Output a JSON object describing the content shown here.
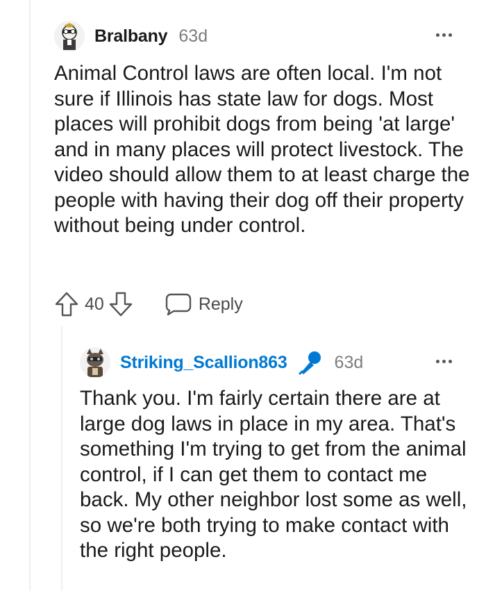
{
  "comments": [
    {
      "username": "Bralbany",
      "time": "63d",
      "avatar": "bralbany-avatar",
      "body": "Animal Control laws are often local. I'm not sure if Illinois has state law for dogs. Most places will prohibit dogs from being 'at large' and in many places will protect livestock. The video should allow them to at least charge the people with having their dog off their property without being under control.",
      "votes": "40",
      "reply_label": "Reply"
    },
    {
      "username": "Striking_Scallion863",
      "time": "63d",
      "is_op": true,
      "badge_icon": "microphone-icon",
      "avatar": "scallion-avatar",
      "body": "Thank you. I'm fairly certain there are at large dog laws in place in my area. That's something I'm trying to get from the animal control, if I can get them to contact me back. My other neighbor lost some as well, so we're both trying to make contact with the right people."
    }
  ],
  "colors": {
    "op_username": "#0079d3",
    "timestamp": "#7c7c7c",
    "thread_line": "#edeff1"
  }
}
